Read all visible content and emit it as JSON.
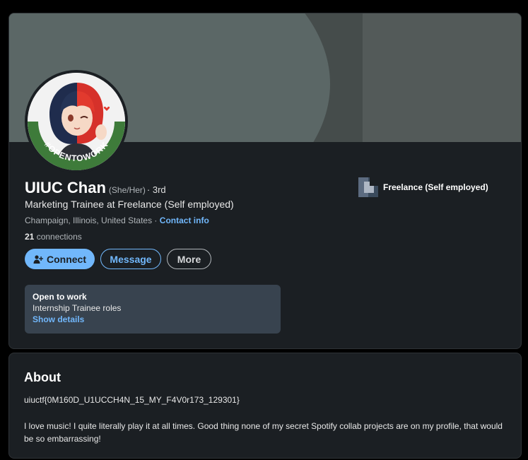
{
  "profile": {
    "name": "UIUC Chan",
    "pronouns": "(She/Her)",
    "degree": "· 3rd",
    "headline": "Marketing Trainee at Freelance (Self employed)",
    "location": "Champaign, Illinois, United States ·",
    "contact_info": "Contact info",
    "connections_count": "21",
    "connections_label": "connections",
    "avatar_badge": "#OPENTOWORK"
  },
  "actions": {
    "connect": "Connect",
    "message": "Message",
    "more": "More"
  },
  "open_to_work": {
    "title": "Open to work",
    "roles": "Internship Trainee roles",
    "link": "Show details"
  },
  "company": {
    "name": "Freelance (Self employed)"
  },
  "about": {
    "title": "About",
    "flag": "uiuctf{0M160D_U1UCCH4N_15_MY_F4V0r173_129301}",
    "body": "I love music! I quite literally play it at all times. Good thing none of my secret Spotify collab projects are on my profile, that would be so embarrassing!"
  },
  "colors": {
    "background": "#000000",
    "card": "#1b1f23",
    "accent": "#71b7fb",
    "otw_box": "#38434f",
    "otw_ring": "#3e7b3a"
  }
}
